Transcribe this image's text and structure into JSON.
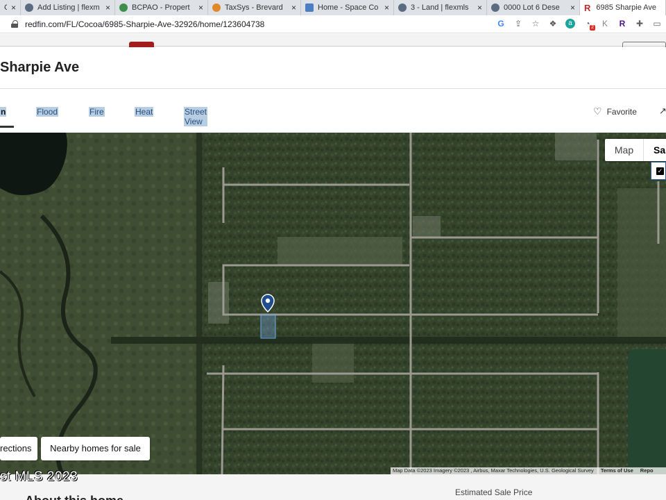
{
  "browser": {
    "tabs": [
      {
        "label": "Co",
        "favicon_color": "#6b7a8f"
      },
      {
        "label": "Add Listing | flexm",
        "favicon_color": "#5b6b82"
      },
      {
        "label": "BCPAO - Propert",
        "favicon_color": "#3c8f4a"
      },
      {
        "label": "TaxSys - Brevard",
        "favicon_color": "#e0892a"
      },
      {
        "label": "Home - Space Co",
        "favicon_color": "#4b7fc1"
      },
      {
        "label": "3 - Land | flexmls",
        "favicon_color": "#5b6b82"
      },
      {
        "label": "0000 Lot 6 Dese",
        "favicon_color": "#5b6b82"
      },
      {
        "label": "6985 Sharpie Ave",
        "favicon_color": "#c62828",
        "favicon_letter": "R"
      }
    ],
    "close_glyph": "×",
    "url": "redfin.com/FL/Cocoa/6985-Sharpie-Ave-32926/home/123604738",
    "toolbar_icons": [
      "google-icon",
      "share-icon",
      "star-icon",
      "dropbox-icon",
      "extension-a-icon",
      "extension-badge-icon",
      "extension-k-icon",
      "extension-r-icon",
      "puzzle-icon",
      "sidebar-icon"
    ],
    "extension_badge": "2"
  },
  "page": {
    "title": "Sharpie Ave",
    "map_tabs": [
      {
        "label": "n"
      },
      {
        "label": "Flood"
      },
      {
        "label": "Fire"
      },
      {
        "label": "Heat"
      },
      {
        "label": "Street View"
      }
    ],
    "favorite_label": "Favorite",
    "map": {
      "type_map": "Map",
      "type_satellite": "Sa",
      "checkbox_glyph": "✓",
      "directions_label": "rections",
      "nearby_label": "Nearby homes for sale",
      "attribution": "Map Data ©2023 Imagery ©2023 , Airbus, Maxar Technologies, U.S. Geological Survey",
      "terms_label": "Terms of Use",
      "report_label": "Repo",
      "mls_watermark": "st MLS 2023"
    },
    "about_heading": "About this home",
    "estimated_label": "Estimated Sale Price"
  }
}
